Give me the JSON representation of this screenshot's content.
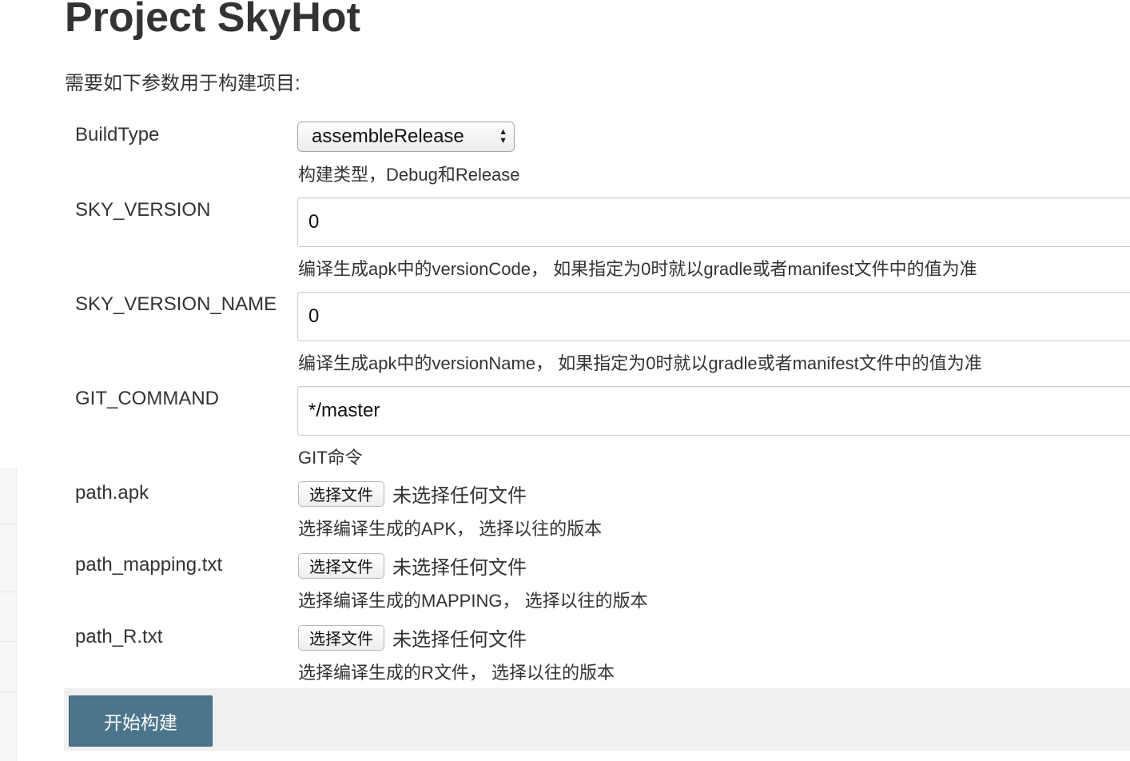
{
  "page": {
    "title": "Project SkyHot",
    "intro": "需要如下参数用于构建项目:"
  },
  "params": {
    "build_type": {
      "label": "BuildType",
      "selected": "assembleRelease",
      "description": "构建类型，Debug和Release"
    },
    "sky_version": {
      "label": "SKY_VERSION",
      "value": "0",
      "description": "编译生成apk中的versionCode， 如果指定为0时就以gradle或者manifest文件中的值为准"
    },
    "sky_version_name": {
      "label": "SKY_VERSION_NAME",
      "value": "0",
      "description": "编译生成apk中的versionName， 如果指定为0时就以gradle或者manifest文件中的值为准"
    },
    "git_command": {
      "label": "GIT_COMMAND",
      "value": "*/master",
      "description": "GIT命令"
    },
    "path_apk": {
      "label": "path.apk",
      "button": "选择文件",
      "status": "未选择任何文件",
      "description": "选择编译生成的APK， 选择以往的版本"
    },
    "path_mapping": {
      "label": "path_mapping.txt",
      "button": "选择文件",
      "status": "未选择任何文件",
      "description": "选择编译生成的MAPPING， 选择以往的版本"
    },
    "path_r": {
      "label": "path_R.txt",
      "button": "选择文件",
      "status": "未选择任何文件",
      "description": "选择编译生成的R文件， 选择以往的版本"
    }
  },
  "actions": {
    "build_label": "开始构建"
  },
  "colors": {
    "build_button": "#4b758b",
    "action_bar": "#f0f0f0",
    "text": "#333333"
  }
}
